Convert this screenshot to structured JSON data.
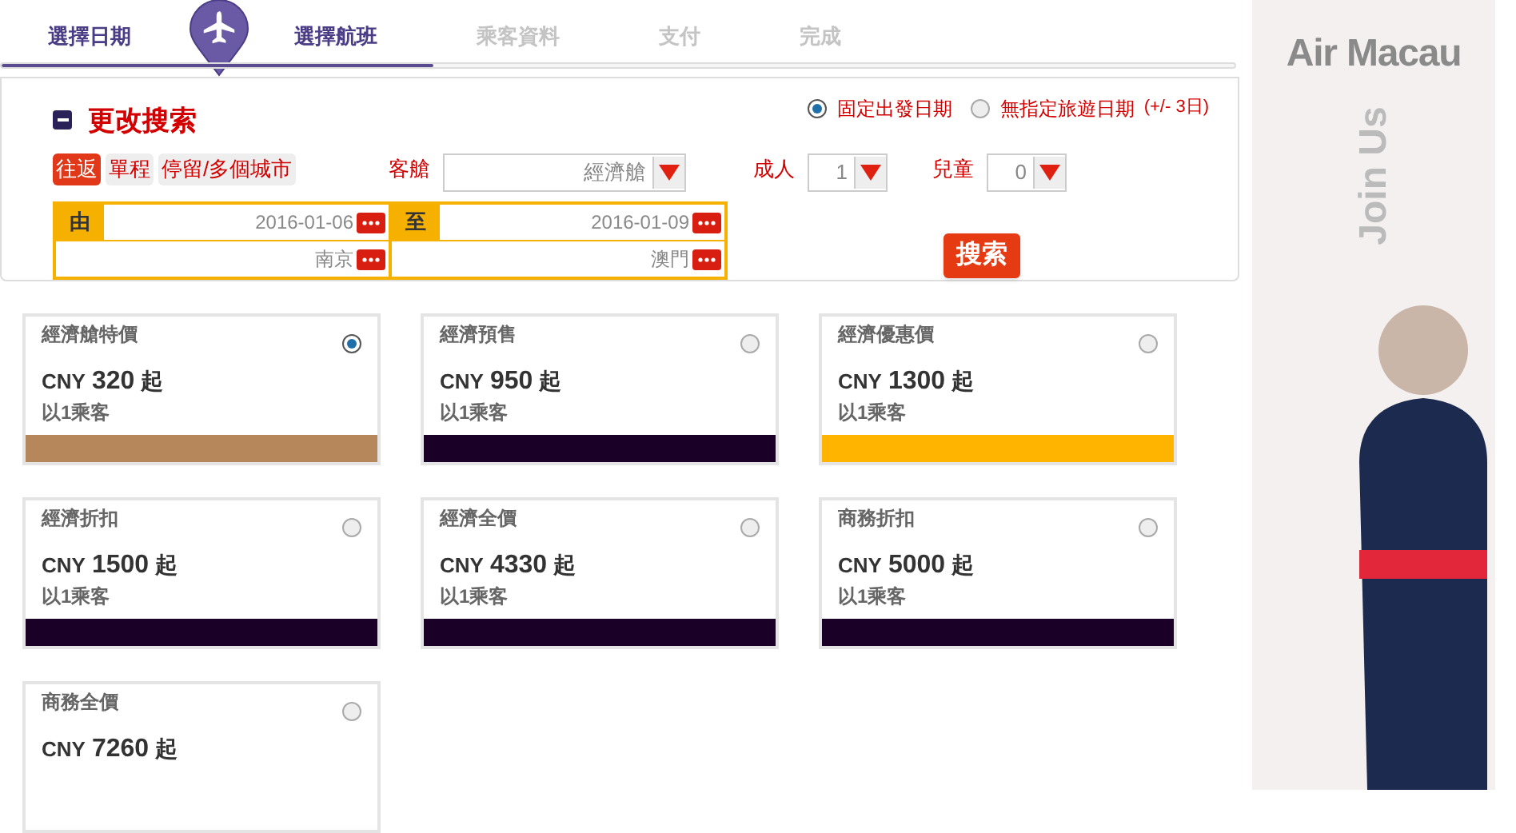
{
  "steps": [
    {
      "label": "選擇日期",
      "done": true
    },
    {
      "label": "選擇航班",
      "done": true
    },
    {
      "label": "乘客資料",
      "done": false
    },
    {
      "label": "支付",
      "done": false
    },
    {
      "label": "完成",
      "done": false
    }
  ],
  "progress": {
    "level": 0.35
  },
  "search": {
    "title": "更改搜索",
    "expanded": true,
    "date_modes": [
      {
        "label": "固定出發日期",
        "selected": true
      },
      {
        "label": "無指定旅遊日期",
        "note": "(+/- 3日)",
        "selected": false
      }
    ],
    "trip_types": [
      {
        "label": "往返",
        "selected": true
      },
      {
        "label": "單程",
        "selected": false
      },
      {
        "label": "停留/多個城市",
        "selected": false
      }
    ],
    "cabin": {
      "label": "客艙",
      "value": "經濟艙"
    },
    "adults": {
      "label": "成人",
      "value": "1"
    },
    "children": {
      "label": "兒童",
      "value": "0"
    },
    "legs": [
      {
        "label": "由",
        "date": "2016-01-06",
        "city": "南京"
      },
      {
        "label": "至",
        "date": "2016-01-09",
        "city": "澳門"
      }
    ],
    "submit": "搜索"
  },
  "fares": [
    {
      "name": "經濟艙特價",
      "currency": "CNY",
      "price": "320",
      "suffix": "起",
      "note": "以1乘客",
      "color": "#b5875a",
      "selected": true
    },
    {
      "name": "經濟預售",
      "currency": "CNY",
      "price": "950",
      "suffix": "起",
      "note": "以1乘客",
      "color": "#1a0026",
      "selected": false
    },
    {
      "name": "經濟優惠價",
      "currency": "CNY",
      "price": "1300",
      "suffix": "起",
      "note": "以1乘客",
      "color": "#ffb400",
      "selected": false
    },
    {
      "name": "經濟折扣",
      "currency": "CNY",
      "price": "1500",
      "suffix": "起",
      "note": "以1乘客",
      "color": "#1a0026",
      "selected": false
    },
    {
      "name": "經濟全價",
      "currency": "CNY",
      "price": "4330",
      "suffix": "起",
      "note": "以1乘客",
      "color": "#1a0026",
      "selected": false
    },
    {
      "name": "商務折扣",
      "currency": "CNY",
      "price": "5000",
      "suffix": "起",
      "note": "以1乘客",
      "color": "#1a0026",
      "selected": false
    },
    {
      "name": "商務全價",
      "currency": "CNY",
      "price": "7260",
      "suffix": "起",
      "selected": false
    }
  ],
  "banner": {
    "title": "Air Macau",
    "tagline": "Join Us"
  }
}
